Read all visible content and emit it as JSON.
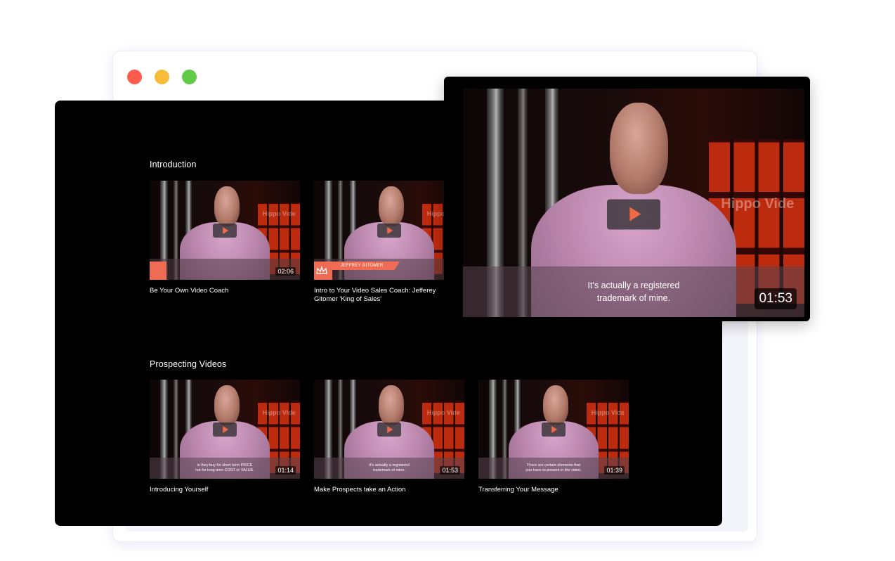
{
  "window": {
    "controls": [
      "close",
      "minimize",
      "maximize"
    ]
  },
  "sections": [
    {
      "title": "Introduction",
      "videos": [
        {
          "title": "Be Your Own Video Coach",
          "duration": "02:06"
        },
        {
          "title": "Intro to Your Video Sales Coach: Jefferey Gitomer 'King of Sales'",
          "duration": "",
          "name_tag": "JEFFREY GITOMER"
        }
      ]
    },
    {
      "title": "Prospecting Videos",
      "videos": [
        {
          "title": "Introducing Yourself",
          "duration": "01:14",
          "caption_line1": "is they buy for short term PRICE",
          "caption_line2": "not for long term COST or VALUE."
        },
        {
          "title": "Make Prospects take an Action",
          "duration": "01:53",
          "caption_line1": "It's actually a registered",
          "caption_line2": "trademark of mine."
        },
        {
          "title": "Transferring Your Message",
          "duration": "01:39",
          "caption_line1": "There are certain elements that",
          "caption_line2": "you have to present in the video."
        }
      ]
    }
  ],
  "preview": {
    "duration": "01:53",
    "caption_line1": "It's actually a registered",
    "caption_line2": "trademark of mine.",
    "watermark": "Hippo Vide"
  },
  "thumb_watermark": "Hippo Vide",
  "colors": {
    "accent": "#ef6b54",
    "dot_red": "#ff5c50",
    "dot_yellow": "#f7bd38",
    "dot_green": "#5fcb47"
  }
}
